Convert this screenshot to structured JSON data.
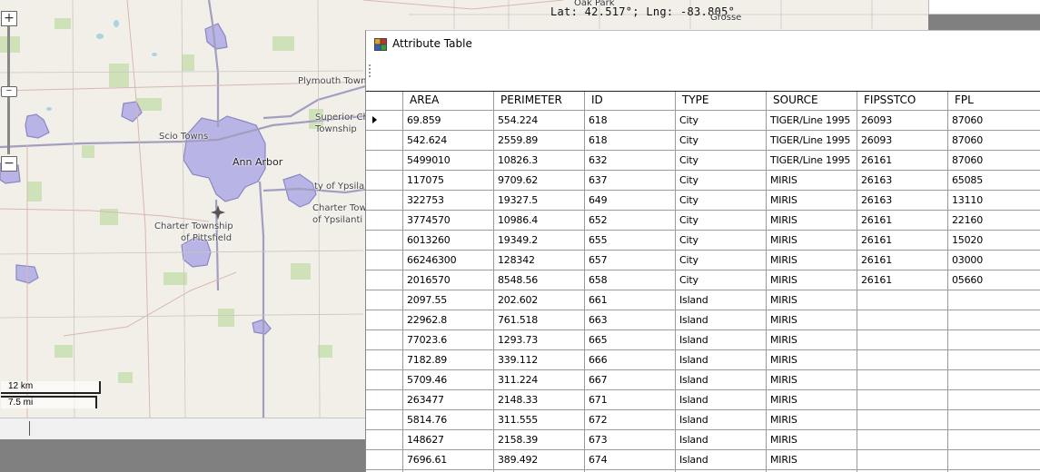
{
  "map": {
    "coordinate_readout": "Lat: 42.517°; Lng: -83.805°",
    "zoom_in_label": "+",
    "zoom_out_label": "−",
    "zoom_thumb_label": "−",
    "scale_km": "12 km",
    "scale_mi": "7.5 mi",
    "labels": {
      "oak_park": "Oak Park",
      "grosse": "Grosse",
      "plymouth_town": "Plymouth Town",
      "superior_ch": "Superior Ch",
      "township": "Township",
      "scio_towns": "Scio Towns",
      "ann_arbor": "Ann Arbor",
      "of_ypsila": "ty of Ypsila",
      "charter_tow": "Charter Tow",
      "of_ypsilanti": "of Ypsilanti",
      "charter_township": "Charter Township",
      "of_pittsfield": "of Pittsfield"
    },
    "colors": {
      "land": "#f2efe9",
      "city_fill": "#b8b4e6",
      "city_outline": "#8a87c4",
      "road": "#a29ec0",
      "water": "#aad3df",
      "green": "#c8dfb0"
    }
  },
  "attribute_table": {
    "title": "Attribute Table",
    "columns": [
      "AREA",
      "PERIMETER",
      "ID",
      "TYPE",
      "SOURCE",
      "FIPSSTCO",
      "FPL"
    ],
    "current_row_index": 0,
    "rows": [
      [
        "69.859",
        "554.224",
        "618",
        "City",
        "TIGER/Line 1995",
        "26093",
        "87060"
      ],
      [
        "542.624",
        "2559.89",
        "618",
        "City",
        "TIGER/Line 1995",
        "26093",
        "87060"
      ],
      [
        "5499010",
        "10826.3",
        "632",
        "City",
        "TIGER/Line 1995",
        "26161",
        "87060"
      ],
      [
        "117075",
        "9709.62",
        "637",
        "City",
        "MIRIS",
        "26163",
        "65085"
      ],
      [
        "322753",
        "19327.5",
        "649",
        "City",
        "MIRIS",
        "26163",
        "13110"
      ],
      [
        "3774570",
        "10986.4",
        "652",
        "City",
        "MIRIS",
        "26161",
        "22160"
      ],
      [
        "6013260",
        "19349.2",
        "655",
        "City",
        "MIRIS",
        "26161",
        "15020"
      ],
      [
        "66246300",
        "128342",
        "657",
        "City",
        "MIRIS",
        "26161",
        "03000"
      ],
      [
        "2016570",
        "8548.56",
        "658",
        "City",
        "MIRIS",
        "26161",
        "05660"
      ],
      [
        "2097.55",
        "202.602",
        "661",
        "Island",
        "MIRIS",
        "",
        ""
      ],
      [
        "22962.8",
        "761.518",
        "663",
        "Island",
        "MIRIS",
        "",
        ""
      ],
      [
        "77023.6",
        "1293.73",
        "665",
        "Island",
        "MIRIS",
        "",
        ""
      ],
      [
        "7182.89",
        "339.112",
        "666",
        "Island",
        "MIRIS",
        "",
        ""
      ],
      [
        "5709.46",
        "311.224",
        "667",
        "Island",
        "MIRIS",
        "",
        ""
      ],
      [
        "263477",
        "2148.33",
        "671",
        "Island",
        "MIRIS",
        "",
        ""
      ],
      [
        "5814.76",
        "311.555",
        "672",
        "Island",
        "MIRIS",
        "",
        ""
      ],
      [
        "148627",
        "2158.39",
        "673",
        "Island",
        "MIRIS",
        "",
        ""
      ],
      [
        "7696.61",
        "389.492",
        "674",
        "Island",
        "MIRIS",
        "",
        ""
      ],
      [
        "",
        "",
        "",
        "",
        "",
        "",
        ""
      ]
    ]
  }
}
